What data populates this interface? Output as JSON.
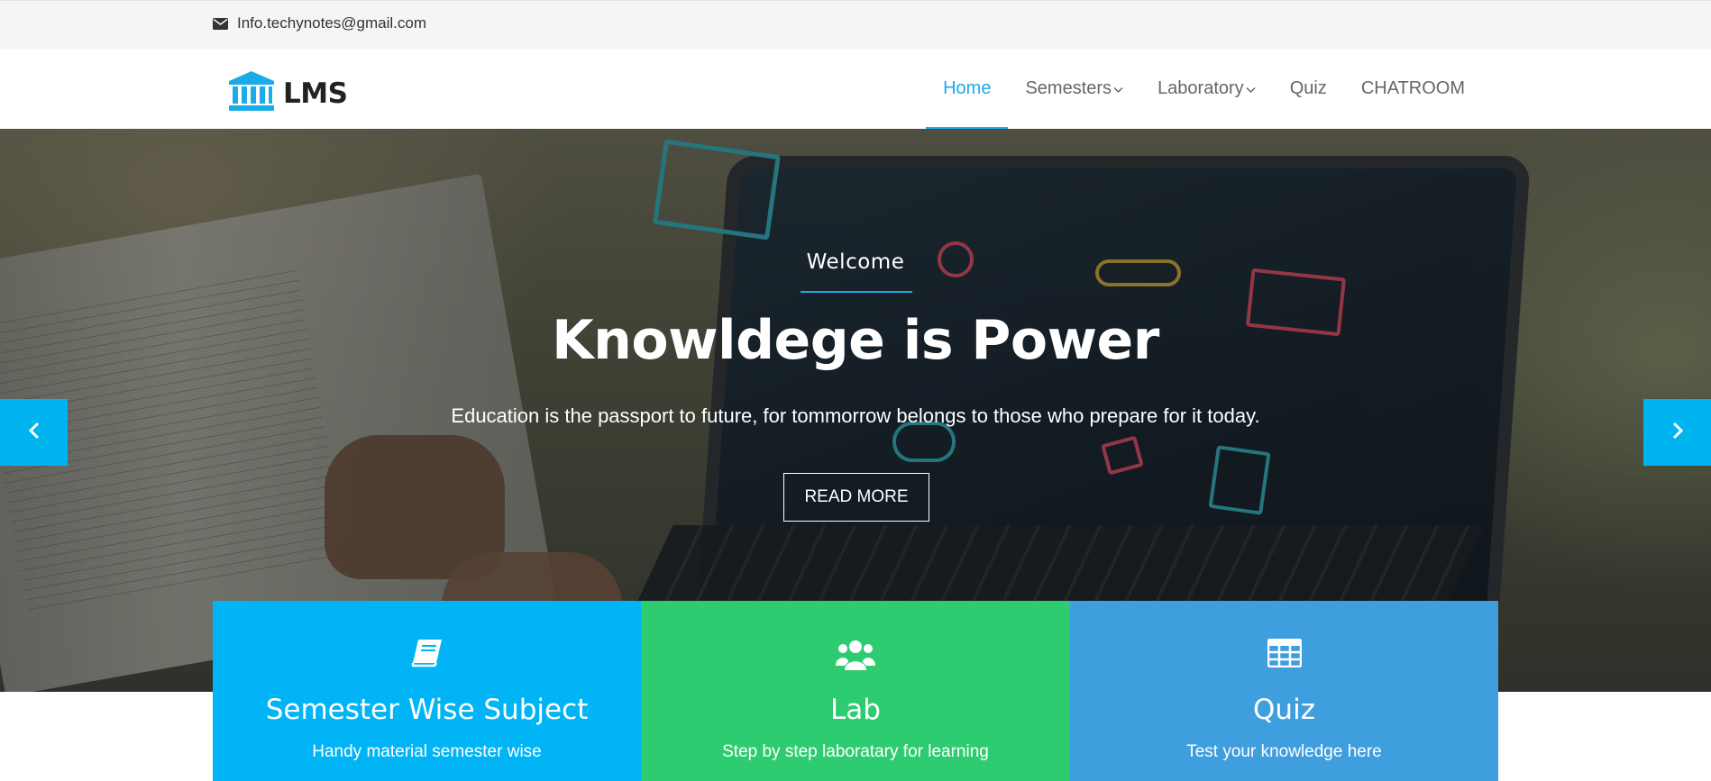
{
  "topbar": {
    "email": "Info.techynotes@gmail.com",
    "email_icon": "envelope-icon"
  },
  "brand": {
    "name": "LMS",
    "logo_icon": "institution-icon"
  },
  "nav": {
    "items": [
      {
        "label": "Home",
        "active": true
      },
      {
        "label": "Semesters",
        "dropdown": true
      },
      {
        "label": "Laboratory",
        "dropdown": true
      },
      {
        "label": "Quiz"
      },
      {
        "label": "CHATROOM"
      }
    ]
  },
  "hero": {
    "kicker": "Welcome",
    "title": "Knowldege is Power",
    "subtitle": "Education is the passport to future, for tommorrow belongs to those who prepare for it today.",
    "cta_label": "READ MORE",
    "prev_icon": "chevron-left-icon",
    "next_icon": "chevron-right-icon"
  },
  "features": [
    {
      "title": "Semester Wise Subject",
      "desc": "Handy material semester wise",
      "icon": "book-icon",
      "color": "#00b4f5"
    },
    {
      "title": "Lab",
      "desc": "Step by step laboratary for learning",
      "icon": "users-icon",
      "color": "#2ecc71"
    },
    {
      "title": "Quiz",
      "desc": "Test your knowledge here",
      "icon": "table-icon",
      "color": "#3e9ede"
    }
  ],
  "colors": {
    "accent": "#1aabe8",
    "arrow_bg": "#00b4ef"
  }
}
